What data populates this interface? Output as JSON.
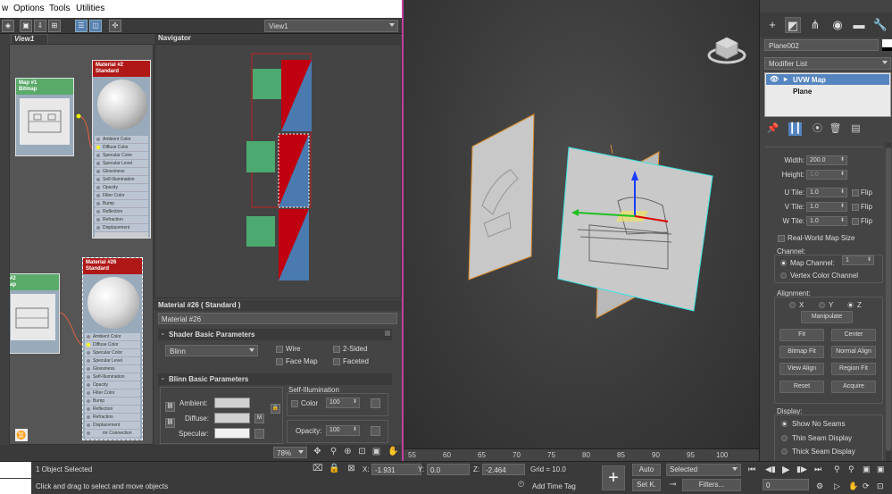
{
  "menubar": {
    "items": [
      "w",
      "Options",
      "Tools",
      "Utilities"
    ]
  },
  "toolbar": {
    "view_dropdown": "View1"
  },
  "view1": {
    "tab_label": "View1",
    "node_map1": {
      "line1": "Map #1",
      "line2": "Bitmap"
    },
    "node_map2": {
      "line1": "#2",
      "line2": "ap"
    },
    "node_material_top": {
      "line1": "Material #2",
      "line2": "Standard"
    },
    "node_material26": {
      "line1": "Material #26",
      "line2": "Standard"
    },
    "slots": [
      "Ambient Color",
      "Diffuse Color",
      "Specular Color",
      "Specular Level",
      "Glossiness",
      "Self-Illumination",
      "Opacity",
      "Filter Color",
      "Bump",
      "Reflection",
      "Refraction",
      "Displacement",
      "mr Connection"
    ]
  },
  "navigator": {
    "title": "Navigator"
  },
  "material": {
    "header": "Material #26  ( Standard )",
    "name": "Material #26",
    "shader_rollout": "Shader Basic Parameters",
    "shader_value": "Blinn",
    "wire": "Wire",
    "two_sided": "2-Sided",
    "face_map": "Face Map",
    "faceted": "Faceted",
    "blinn_rollout": "Blinn Basic Parameters",
    "ambient": "Ambient:",
    "diffuse": "Diffuse:",
    "specular": "Specular:",
    "m_button": "M",
    "self_illum": "Self-Illumination",
    "color": "Color",
    "color_value": "100",
    "opacity": "Opacity:",
    "opacity_value": "100"
  },
  "sme_status": {
    "zoom": "78%"
  },
  "ruler": {
    "ticks": [
      "55",
      "60",
      "65",
      "70",
      "75",
      "80",
      "85",
      "90",
      "95",
      "100"
    ]
  },
  "command_panel": {
    "object_name": "Plane002",
    "object_color": "#ffffff",
    "modifier_list": "Modifier List",
    "stack": [
      "UVW Map",
      "Plane"
    ],
    "width_label": "Width:",
    "width_value": "200.0",
    "height_label": "Height:",
    "height_value": "1.0",
    "utile_label": "U Tile:",
    "utile_value": "1.0",
    "vtile_label": "V Tile:",
    "vtile_value": "1.0",
    "wtile_label": "W Tile:",
    "wtile_value": "1.0",
    "flip": "Flip",
    "real_world": "Real-World Map Size",
    "channel_title": "Channel:",
    "map_channel": "Map Channel:",
    "map_channel_value": "1",
    "vertex_color_channel": "Vertex Color Channel",
    "alignment_title": "Alignment:",
    "axis_x": "X",
    "axis_y": "Y",
    "axis_z": "Z",
    "manipulate": "Manipulate",
    "fit": "Fit",
    "center": "Center",
    "bitmap_fit": "Bitmap Fit",
    "normal_align": "Normal Align",
    "view_align": "View Align",
    "region_fit": "Region Fit",
    "reset": "Reset",
    "acquire": "Acquire",
    "display_title": "Display:",
    "show_no_seams": "Show No Seams",
    "thin_seam": "Thin Seam Display",
    "thick_seam": "Thick Seam Display"
  },
  "bottom": {
    "status1": "1 Object Selected",
    "status2": "Click and drag to select and move objects",
    "x_label": "X:",
    "x_value": "-1.931",
    "y_label": "Y:",
    "y_value": "0.0",
    "z_label": "Z:",
    "z_value": "-2.464",
    "grid": "Grid = 10.0",
    "add_time_tag": "Add Time Tag",
    "auto": "Auto",
    "selected": "Selected",
    "set_key": "Set K.",
    "filters": "Filters...",
    "frame": "0"
  }
}
